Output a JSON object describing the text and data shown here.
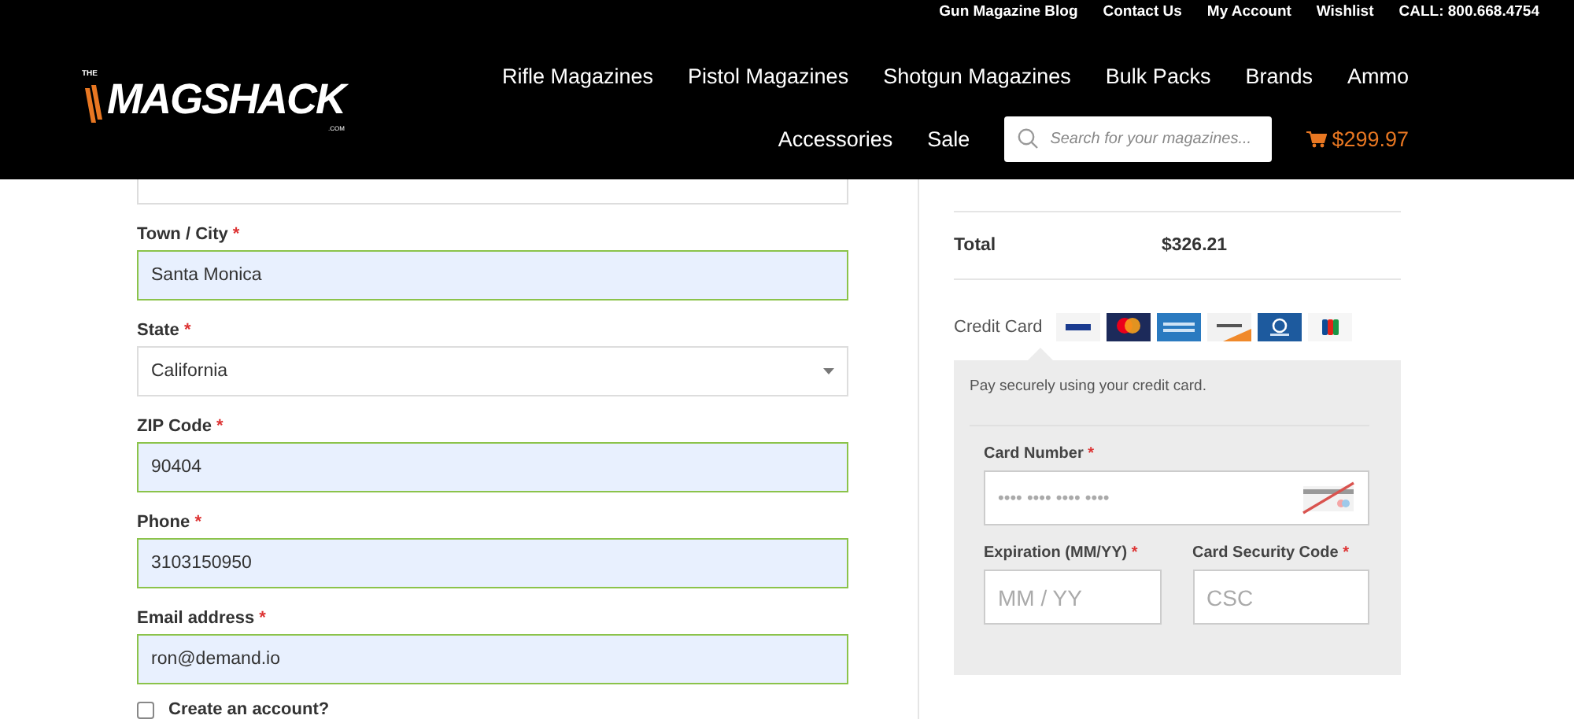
{
  "top_links": [
    "Gun Magazine Blog",
    "Contact Us",
    "My Account",
    "Wishlist",
    "CALL: 800.668.4754"
  ],
  "logo": {
    "prefix": "THE",
    "name": "MAGSHACK",
    "suffix": ".COM"
  },
  "nav": [
    [
      "Rifle Magazines",
      "Pistol Magazines",
      "Shotgun Magazines",
      "Bulk Packs",
      "Brands",
      "Ammo"
    ],
    [
      "Accessories",
      "Sale"
    ]
  ],
  "search": {
    "placeholder": "Search for your magazines..."
  },
  "cart": {
    "total": "$299.97"
  },
  "billing_fields": [
    {
      "kind": "partial",
      "autofilled": false
    },
    {
      "kind": "text",
      "label": "Town / City",
      "required_mark": "*",
      "value": "Santa Monica",
      "autofilled": true
    },
    {
      "kind": "select",
      "label": "State",
      "required_mark": "*",
      "value": "California",
      "autofilled": false
    },
    {
      "kind": "text",
      "label": "ZIP Code",
      "required_mark": "*",
      "value": "90404",
      "autofilled": true
    },
    {
      "kind": "text",
      "label": "Phone",
      "required_mark": "*",
      "value": "3103150950",
      "autofilled": true
    },
    {
      "kind": "text",
      "label": "Email address",
      "required_mark": "*",
      "value": "ron@demand.io",
      "autofilled": true
    }
  ],
  "create_account": {
    "label": "Create an account?",
    "checked": false
  },
  "summary": [
    {
      "kind": "partial"
    },
    {
      "kind": "full",
      "label": "Total",
      "value": "$326.21"
    }
  ],
  "payment": {
    "label": "Credit Card",
    "cards": [
      {
        "kind": "visa"
      },
      {
        "kind": "mastercard"
      },
      {
        "kind": "amex"
      },
      {
        "kind": "discover"
      },
      {
        "kind": "diners"
      },
      {
        "kind": "jcb"
      }
    ],
    "description": "Pay securely using your credit card.",
    "card_number": {
      "label": "Card Number",
      "required_mark": "*",
      "placeholder": "•••• •••• •••• ••••"
    },
    "expiration": {
      "label": "Expiration (MM/YY)",
      "required_mark": "*",
      "placeholder": "MM / YY"
    },
    "security_code": {
      "label": "Card Security Code",
      "required_mark": "*",
      "placeholder": "CSC"
    }
  }
}
